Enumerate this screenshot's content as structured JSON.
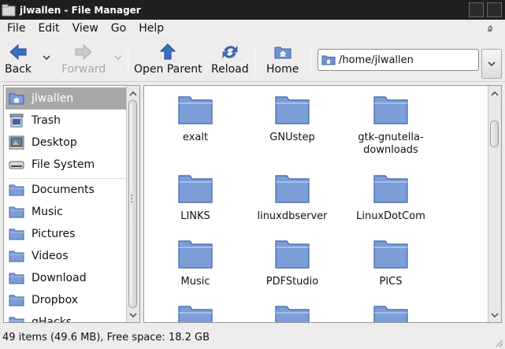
{
  "window": {
    "title": "jlwallen - File Manager"
  },
  "menubar": {
    "items": [
      "File",
      "Edit",
      "View",
      "Go",
      "Help"
    ]
  },
  "toolbar": {
    "back": "Back",
    "forward": "Forward",
    "open_parent": "Open Parent",
    "reload": "Reload",
    "home": "Home"
  },
  "location": {
    "path": "/home/jlwallen"
  },
  "sidebar": {
    "places": [
      {
        "label": "jlwallen",
        "icon": "home-folder-icon",
        "selected": true
      },
      {
        "label": "Trash",
        "icon": "trash-icon"
      },
      {
        "label": "Desktop",
        "icon": "desktop-icon"
      },
      {
        "label": "File System",
        "icon": "drive-icon"
      }
    ],
    "bookmarks": [
      {
        "label": "Documents",
        "icon": "folder-icon"
      },
      {
        "label": "Music",
        "icon": "folder-icon"
      },
      {
        "label": "Pictures",
        "icon": "folder-icon"
      },
      {
        "label": "Videos",
        "icon": "folder-icon"
      },
      {
        "label": "Download",
        "icon": "folder-icon"
      },
      {
        "label": "Dropbox",
        "icon": "folder-icon"
      },
      {
        "label": "gHacks",
        "icon": "folder-icon"
      }
    ]
  },
  "files": [
    {
      "name": "exalt"
    },
    {
      "name": "GNUstep"
    },
    {
      "name": "gtk-gnutella-downloads"
    },
    {
      "name": "LINKS"
    },
    {
      "name": "linuxdbserver"
    },
    {
      "name": "LinuxDotCom"
    },
    {
      "name": "Music"
    },
    {
      "name": "PDFStudio"
    },
    {
      "name": "PICS"
    },
    {
      "name": ""
    },
    {
      "name": ""
    },
    {
      "name": ""
    }
  ],
  "status": {
    "text": "49 items (49.6 MB), Free space: 18.2 GB"
  },
  "colors": {
    "folder_fill": "#7c9ed8",
    "folder_edge": "#3e64a6",
    "titlebar": "#1f1f1f",
    "selection": "#a8a8a8"
  }
}
